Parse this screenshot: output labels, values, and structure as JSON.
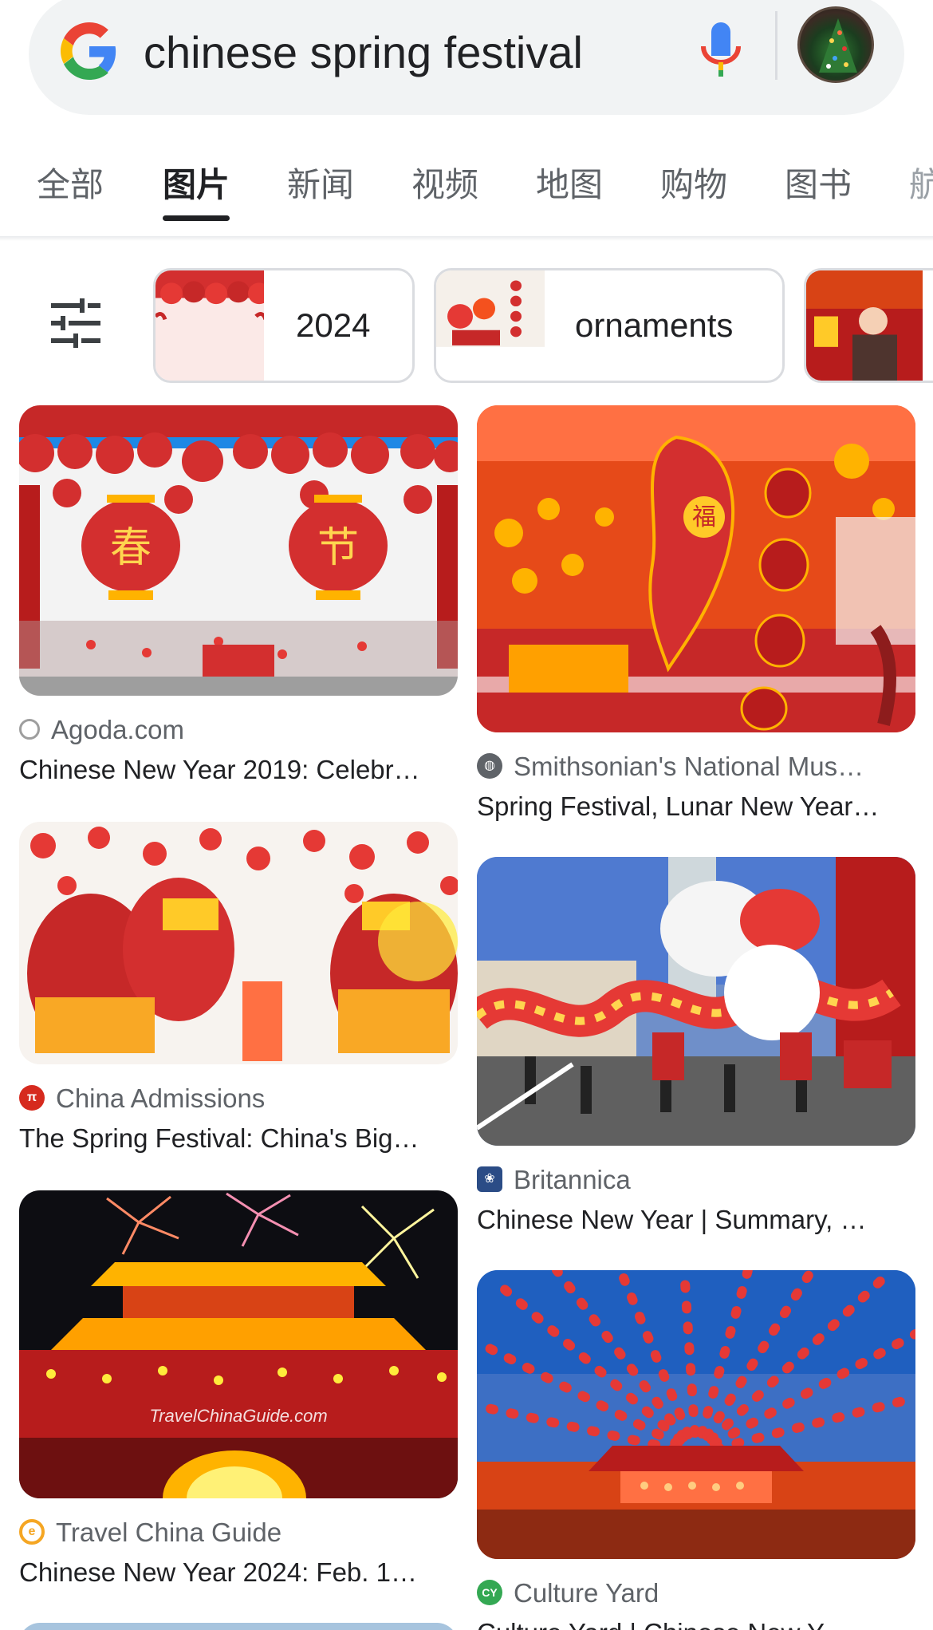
{
  "search": {
    "query": "chinese spring festival"
  },
  "tabs": [
    {
      "label": "全部",
      "active": false
    },
    {
      "label": "图片",
      "active": true
    },
    {
      "label": "新闻",
      "active": false
    },
    {
      "label": "视频",
      "active": false
    },
    {
      "label": "地图",
      "active": false
    },
    {
      "label": "购物",
      "active": false
    },
    {
      "label": "图书",
      "active": false
    },
    {
      "label": "航",
      "active": false
    }
  ],
  "chips": [
    {
      "label": "2024"
    },
    {
      "label": "ornaments"
    }
  ],
  "results": [
    {
      "source": "Agoda.com",
      "title": "Chinese New Year 2019: Celebr…",
      "thumb_text": [
        "春",
        "节"
      ]
    },
    {
      "source": "Smithsonian's National Mus…",
      "title": "Spring Festival, Lunar New Year…",
      "thumb_text": [
        "福"
      ]
    },
    {
      "source": "China Admissions",
      "title": "The Spring Festival: China's Big…"
    },
    {
      "source": "Britannica",
      "title": "Chinese New Year | Summary, …"
    },
    {
      "source": "Travel China Guide",
      "title": "Chinese New Year 2024: Feb. 1…",
      "thumb_text": [
        "TravelChinaGuide.com"
      ]
    },
    {
      "source": "Culture Yard",
      "title": "Culture Yard | Chinese New Y…"
    }
  ],
  "colors": {
    "accent_red": "#d62a1e",
    "chip_border": "#dadce0",
    "search_bg": "#f1f3f4",
    "muted_text": "#5f6368"
  }
}
